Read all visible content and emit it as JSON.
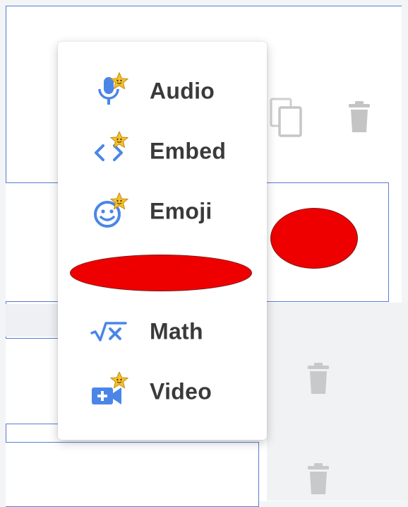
{
  "menu": {
    "items": [
      {
        "label": "Audio",
        "icon": "mic-star-icon"
      },
      {
        "label": "Embed",
        "icon": "code-star-icon"
      },
      {
        "label": "Emoji",
        "icon": "emoji-star-icon"
      },
      {
        "label": "Math",
        "icon": "sqrt-x-icon"
      },
      {
        "label": "Video",
        "icon": "video-add-star-icon"
      }
    ]
  },
  "colors": {
    "accent": "#4a86e8",
    "star": "#f6c12c",
    "border": "#5b7bd6",
    "redaction": "#ee0000",
    "icon_gray": "#c4c4c4"
  }
}
